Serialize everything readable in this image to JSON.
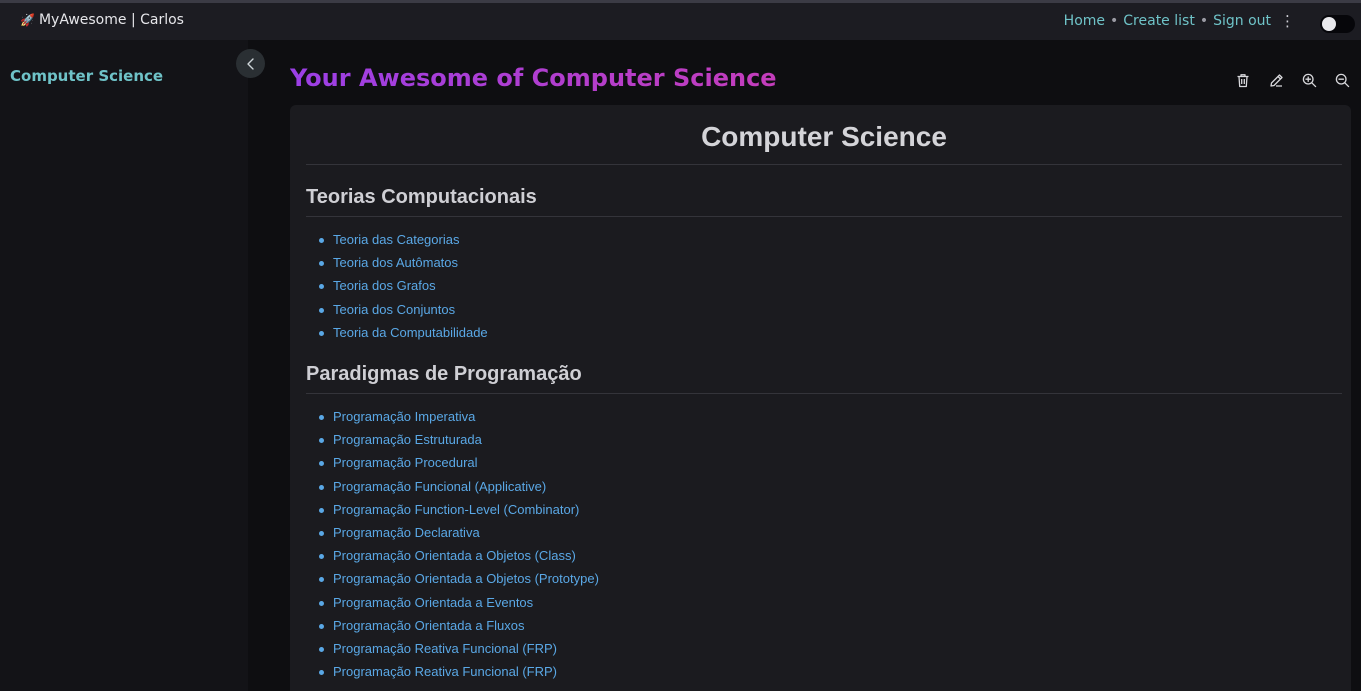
{
  "navbar": {
    "brand_icon": "rocket-icon",
    "brand": "MyAwesome | Carlos",
    "links": [
      "Home",
      "Create list",
      "Sign out"
    ],
    "separator": "•",
    "more_icon": "kebab-menu-icon",
    "theme_toggle": "theme-toggle"
  },
  "sidebar": {
    "title": "Computer Science",
    "collapse_icon": "chevron-left-icon"
  },
  "main": {
    "heading": "Your Awesome of Computer Science",
    "toolbar_icons": [
      "trash-icon",
      "edit-icon",
      "zoom-in-icon",
      "zoom-out-icon"
    ],
    "document": {
      "title": "Computer Science",
      "sections": [
        {
          "title": "Teorias Computacionais",
          "items": [
            "Teoria das Categorias",
            "Teoria dos Autômatos",
            "Teoria dos Grafos",
            "Teoria dos Conjuntos",
            "Teoria da Computabilidade"
          ]
        },
        {
          "title": "Paradigmas de Programação",
          "items": [
            "Programação Imperativa",
            "Programação Estruturada",
            "Programação Procedural",
            "Programação Funcional (Applicative)",
            "Programação Function-Level (Combinator)",
            "Programação Declarativa",
            "Programação Orientada a Objetos (Class)",
            "Programação Orientada a Objetos (Prototype)",
            "Programação Orientada a Eventos",
            "Programação Orientada a Fluxos",
            "Programação Reativa Funcional (FRP)",
            "Programação Reativa Funcional (FRP)"
          ]
        }
      ]
    }
  },
  "colors": {
    "accent_teal": "#6fc3c8",
    "link_blue": "#5aa8e6",
    "heading_gradient_start": "#9b3fe6",
    "heading_gradient_end": "#c43dbb"
  }
}
